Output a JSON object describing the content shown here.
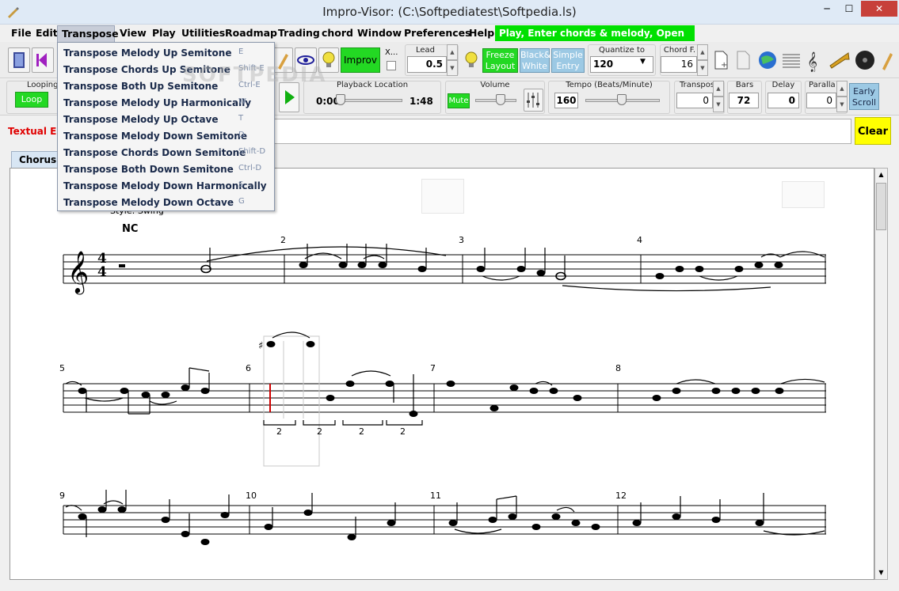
{
  "window": {
    "title": "Impro-Visor: (C:\\Softpediatest\\Softpedia.ls)",
    "min": "─",
    "max": "☐",
    "close": "✕"
  },
  "menubar": {
    "items": [
      "File",
      "Edit",
      "Transpose",
      "View",
      "Play",
      "Utilities",
      "Roadmap",
      "Trading",
      "chord",
      "Window",
      "Preferences",
      "Help"
    ],
    "hint": "Play, Enter chords & melody, Open file, etc."
  },
  "transpose_menu": [
    {
      "label": "Transpose Melody Up Semitone",
      "key": "E"
    },
    {
      "label": "Transpose Chords Up Semitone",
      "key": "Shift-E"
    },
    {
      "label": "Transpose Both Up Semitone",
      "key": "Ctrl-E"
    },
    {
      "label": "Transpose Melody Up Harmonically",
      "key": "W"
    },
    {
      "label": "Transpose Melody Up Octave",
      "key": "T"
    },
    {
      "label": "Transpose Melody Down Semitone",
      "key": "D"
    },
    {
      "label": "Transpose Chords Down Semitone",
      "key": "Shift-D"
    },
    {
      "label": "Transpose Both Down Semitone",
      "key": "Ctrl-D"
    },
    {
      "label": "Transpose Melody Down Harmonically",
      "key": "S"
    },
    {
      "label": "Transpose Melody Down Octave",
      "key": "G"
    }
  ],
  "toolbar1": {
    "improv": "Improv",
    "x_label": "X...",
    "lead_label": "Lead",
    "lead_value": "0.5",
    "freeze_layout": [
      "Freeze",
      "Layout"
    ],
    "black_white": [
      "Black&",
      "White"
    ],
    "simple_entry": [
      "Simple",
      "Entry"
    ],
    "quantize_label": "Quantize to",
    "quantize_value": "120",
    "chord_f_label": "Chord F.",
    "chord_f_value": "16"
  },
  "toolbar2": {
    "looping_label": "Looping",
    "loop_button": "Loop",
    "playback_label": "Playback Location",
    "playback_start": "0:00",
    "playback_end": "1:48",
    "volume_label": "Volume",
    "mute_button": "Mute",
    "tempo_label": "Tempo (Beats/Minute)",
    "tempo_value": "160",
    "transpose_label": "Transpos",
    "transpose_value": "0",
    "bars_label": "Bars",
    "bars_value": "72",
    "delay_label": "Delay",
    "delay_value": "0",
    "parallax_label": "Paralla",
    "parallax_value": "0",
    "early_scroll": [
      "Early",
      "Scroll"
    ]
  },
  "textual_entry": {
    "label": "Textual Ent",
    "clear": "Clear"
  },
  "tab": {
    "label": "Chorus 1"
  },
  "score": {
    "style": "Style: Swing",
    "chord_nc": "NC",
    "time_sig": [
      "4",
      "4"
    ],
    "measure_numbers": [
      "2",
      "3",
      "4",
      "5",
      "6",
      "7",
      "8",
      "9",
      "10",
      "11",
      "12"
    ],
    "triplet_marks": [
      "2",
      "2",
      "2",
      "2"
    ]
  },
  "watermark": "SOFTPEDIA"
}
